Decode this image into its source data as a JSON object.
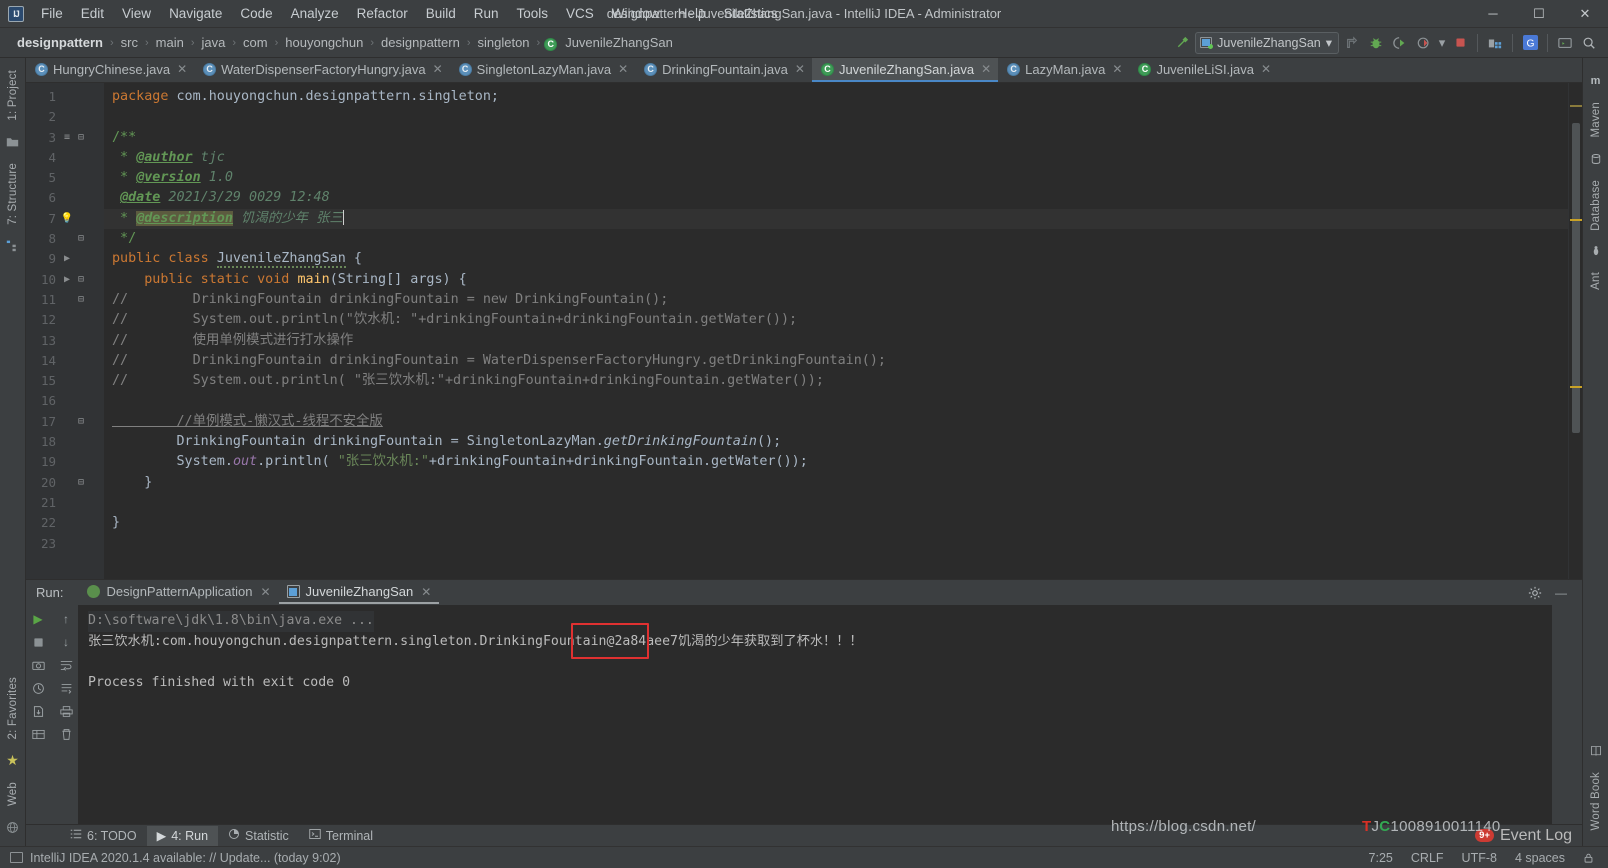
{
  "window": {
    "title": "designpattern - JuvenileZhangSan.java - IntelliJ IDEA - Administrator",
    "logo": "IJ",
    "minimize": "─",
    "maximize": "☐",
    "close": "✕"
  },
  "menu": [
    {
      "label": "File"
    },
    {
      "label": "Edit"
    },
    {
      "label": "View"
    },
    {
      "label": "Navigate"
    },
    {
      "label": "Code"
    },
    {
      "label": "Analyze"
    },
    {
      "label": "Refactor"
    },
    {
      "label": "Build"
    },
    {
      "label": "Run"
    },
    {
      "label": "Tools"
    },
    {
      "label": "VCS"
    },
    {
      "label": "Window"
    },
    {
      "label": "Help"
    },
    {
      "label": "Statistics"
    }
  ],
  "breadcrumb": {
    "items": [
      "designpattern",
      "src",
      "main",
      "java",
      "com",
      "houyongchun",
      "designpattern",
      "singleton"
    ],
    "file": "JuvenileZhangSan",
    "separator": "›"
  },
  "toolbar": {
    "run_config": "JuvenileZhangSan",
    "dropdown_arrow": "▾",
    "icons": [
      "build-hammer-icon",
      "rerun-icon",
      "debug-bug-icon",
      "run-with-coverage-icon",
      "profiler-icon",
      "stop-icon",
      "project-structure-icon",
      "translate-icon",
      "terminal-icon",
      "search-everywhere-icon"
    ]
  },
  "left_strip": {
    "tabs": [
      "1: Project",
      "7: Structure",
      "2: Favorites",
      "Web"
    ]
  },
  "right_strip": {
    "tabs": [
      "Maven",
      "Database",
      "Ant",
      "Word Book"
    ]
  },
  "editor_tabs": [
    {
      "label": "HungryChinese.java",
      "icon": "class-icon",
      "active": false
    },
    {
      "label": "WaterDispenserFactoryHungry.java",
      "icon": "class-icon",
      "active": false
    },
    {
      "label": "SingletonLazyMan.java",
      "icon": "class-icon",
      "active": false
    },
    {
      "label": "DrinkingFountain.java",
      "icon": "class-icon",
      "active": false
    },
    {
      "label": "JuvenileZhangSan.java",
      "icon": "runnable-class-icon",
      "active": true
    },
    {
      "label": "LazyMan.java",
      "icon": "class-icon",
      "active": false
    },
    {
      "label": "JuvenileLiSI.java",
      "icon": "runnable-class-icon",
      "active": false
    }
  ],
  "tab_close_glyph": "✕",
  "editor": {
    "first_line": 1,
    "last_line": 23,
    "lines": [
      {
        "n": 1,
        "marker": "",
        "fold": "",
        "run": false
      },
      {
        "n": 2,
        "marker": "",
        "fold": "",
        "run": false
      },
      {
        "n": 3,
        "marker": "doc-comment-icon",
        "fold": "⊖",
        "run": false
      },
      {
        "n": 4,
        "marker": "",
        "fold": "",
        "run": false
      },
      {
        "n": 5,
        "marker": "",
        "fold": "",
        "run": false
      },
      {
        "n": 6,
        "marker": "",
        "fold": "",
        "run": false
      },
      {
        "n": 7,
        "marker": "",
        "fold": "",
        "run": false
      },
      {
        "n": 8,
        "marker": "",
        "fold": "⊖",
        "run": false
      },
      {
        "n": 9,
        "marker": "",
        "fold": "",
        "run": true
      },
      {
        "n": 10,
        "marker": "",
        "fold": "⊖",
        "run": true
      },
      {
        "n": 11,
        "marker": "",
        "fold": "⊖",
        "run": false
      },
      {
        "n": 12,
        "marker": "",
        "fold": "",
        "run": false
      },
      {
        "n": 13,
        "marker": "",
        "fold": "",
        "run": false
      },
      {
        "n": 14,
        "marker": "",
        "fold": "",
        "run": false
      },
      {
        "n": 15,
        "marker": "",
        "fold": "",
        "run": false
      },
      {
        "n": 16,
        "marker": "",
        "fold": "",
        "run": false
      },
      {
        "n": 17,
        "marker": "",
        "fold": "⊖",
        "run": false
      },
      {
        "n": 18,
        "marker": "",
        "fold": "",
        "run": false
      },
      {
        "n": 19,
        "marker": "",
        "fold": "",
        "run": false
      },
      {
        "n": 20,
        "marker": "",
        "fold": "⊖",
        "run": false
      },
      {
        "n": 21,
        "marker": "",
        "fold": "",
        "run": false
      },
      {
        "n": 22,
        "marker": "",
        "fold": "",
        "run": false
      },
      {
        "n": 23,
        "marker": "",
        "fold": "",
        "run": false
      }
    ],
    "code": {
      "l1_kw": "package",
      "l1_rest": " com.houyongchun.designpattern.singleton;",
      "l3": "/**",
      "l4_star": " * ",
      "l4_tag": "@author",
      "l4_val": " tjc",
      "l5_star": " * ",
      "l5_tag": "@version",
      "l5_val": " 1.0",
      "l6_star": " ",
      "l6_tag": "@date",
      "l6_val": " 2021/3/29 0029 12:48",
      "l7_star": " * ",
      "l7_tag": "@description",
      "l7_val": " 饥渴的少年 张三",
      "l8": " */",
      "l9_a": "public class ",
      "l9_b": "JuvenileZhangSan",
      "l9_c": " {",
      "l10_a": "    public static void ",
      "l10_b": "main",
      "l10_c": "(String[] args) {",
      "l11": "//        DrinkingFountain drinkingFountain = new DrinkingFountain();",
      "l12": "//        System.out.println(\"饮水机: \"+drinkingFountain+drinkingFountain.getWater());",
      "l13": "//        使用单例模式进行打水操作",
      "l14": "//        DrinkingFountain drinkingFountain = WaterDispenserFactoryHungry.getDrinkingFountain();",
      "l15": "//        System.out.println( \"张三饮水机:\"+drinkingFountain+drinkingFountain.getWater());",
      "l17": "        //单例模式-懒汉式-线程不安全版",
      "l18_a": "        DrinkingFountain drinkingFountain = SingletonLazyMan.",
      "l18_b": "getDrinkingFountain",
      "l18_c": "();",
      "l19_a": "        System.",
      "l19_b": "out",
      "l19_c": ".println( ",
      "l19_d": "\"张三饮水机:\"",
      "l19_e": "+drinkingFountain+drinkingFountain.getWater());",
      "l20": "    }",
      "l22": "}"
    }
  },
  "run_panel": {
    "label": "Run:",
    "tabs": [
      {
        "label": "DesignPatternApplication",
        "icon": "spring-leaf-icon",
        "active": false
      },
      {
        "label": "JuvenileZhangSan",
        "icon": "java-app-icon",
        "active": true
      }
    ],
    "close_glyph": "✕",
    "settings_icon": "gear-icon",
    "minimize_icon": "minimize-icon",
    "side_icons": [
      "rerun-icon",
      "scroll-up-icon",
      "stop-icon",
      "scroll-down-icon",
      "screenshot-icon",
      "soft-wrap-icon",
      "dump-threads-icon",
      "scroll-to-end-icon",
      "print-icon",
      "export-icon",
      "clear-all-icon"
    ],
    "console": {
      "line1": "D:\\software\\jdk\\1.8\\bin\\java.exe ...",
      "line2_pre": "张三饮水机:com.houyongchun.designpattern.singleton.DrinkingFountain",
      "line2_hash": "@2a84aee7",
      "line2_post": "饥渴的少年获取到了杯水！！！",
      "line3": "Process finished with exit code 0"
    },
    "annotation_color": "#e03131"
  },
  "bottom_tabs": [
    {
      "label": "6: TODO",
      "accel": "6",
      "icon": "todo-list-icon",
      "active": false
    },
    {
      "label": "4: Run",
      "accel": "4",
      "icon": "run-triangle-icon",
      "active": true
    },
    {
      "label": "Statistic",
      "accel": "",
      "icon": "pie-chart-icon",
      "active": false
    },
    {
      "label": "Terminal",
      "accel": "",
      "icon": "terminal-icon",
      "active": false
    }
  ],
  "event_log": {
    "label": "Event Log",
    "badge": "9+"
  },
  "status_bar": {
    "message": "IntelliJ IDEA 2020.1.4 available: // Update... (today 9:02)",
    "caret": "7:25",
    "line_separator": "CRLF",
    "encoding": "UTF-8",
    "indent": "4 spaces",
    "lock_icon": "lock-icon"
  },
  "watermark": {
    "text1": "https://blog.csdn.net/",
    "text2": "TJC100891001140",
    "tail": "1140"
  },
  "colors": {
    "accent_blue": "#4a88c7",
    "keyword_orange": "#cc7832",
    "string_green": "#6a8759",
    "comment_gray": "#808080",
    "javadoc_green": "#629755",
    "bg_editor": "#2b2b2b",
    "bg_chrome": "#3c3f41",
    "annotation_red": "#e03131"
  }
}
